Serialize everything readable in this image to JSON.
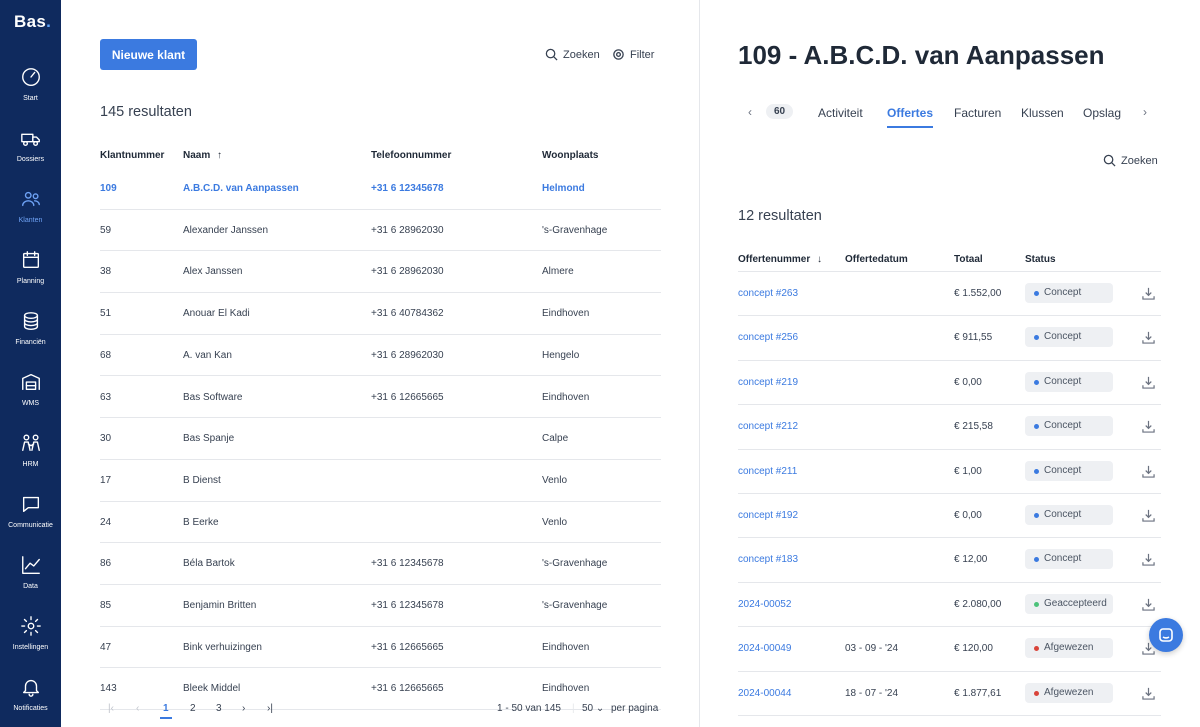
{
  "app": {
    "logo": "Bas"
  },
  "sidebar": {
    "items": [
      {
        "label": "Start",
        "icon": "gauge-icon"
      },
      {
        "label": "Dossiers",
        "icon": "truck-icon"
      },
      {
        "label": "Klanten",
        "icon": "users-icon",
        "active": true
      },
      {
        "label": "Planning",
        "icon": "calendar-icon"
      },
      {
        "label": "Financiën",
        "icon": "coins-icon"
      },
      {
        "label": "WMS",
        "icon": "warehouse-icon"
      },
      {
        "label": "HRM",
        "icon": "people-icon"
      },
      {
        "label": "Communicatie",
        "icon": "chat-icon"
      },
      {
        "label": "Data",
        "icon": "chart-icon"
      },
      {
        "label": "Instellingen",
        "icon": "gear-icon"
      },
      {
        "label": "Notificaties",
        "icon": "bell-icon"
      }
    ]
  },
  "customers": {
    "new_button": "Nieuwe klant",
    "search_label": "Zoeken",
    "filter_label": "Filter",
    "results": "145 resultaten",
    "columns": {
      "number": "Klantnummer",
      "name": "Naam",
      "phone": "Telefoonnummer",
      "city": "Woonplaats"
    },
    "rows": [
      {
        "number": "109",
        "name": "A.B.C.D. van Aanpassen",
        "phone": "+31 6 12345678",
        "city": "Helmond",
        "selected": true
      },
      {
        "number": "59",
        "name": "Alexander Janssen",
        "phone": "+31 6 28962030",
        "city": "'s-Gravenhage"
      },
      {
        "number": "38",
        "name": "Alex Janssen",
        "phone": "+31 6 28962030",
        "city": "Almere"
      },
      {
        "number": "51",
        "name": "Anouar El Kadi",
        "phone": "+31 6 40784362",
        "city": "Eindhoven"
      },
      {
        "number": "68",
        "name": "A. van Kan",
        "phone": "+31 6 28962030",
        "city": "Hengelo"
      },
      {
        "number": "63",
        "name": "Bas Software",
        "phone": "+31 6 12665665",
        "city": "Eindhoven"
      },
      {
        "number": "30",
        "name": "Bas Spanje",
        "phone": "",
        "city": "Calpe"
      },
      {
        "number": "17",
        "name": "B Dienst",
        "phone": "",
        "city": "Venlo"
      },
      {
        "number": "24",
        "name": "B Eerke",
        "phone": "",
        "city": "Venlo"
      },
      {
        "number": "86",
        "name": "Béla Bartok",
        "phone": "+31 6 12345678",
        "city": "'s-Gravenhage"
      },
      {
        "number": "85",
        "name": "Benjamin Britten",
        "phone": "+31 6 12345678",
        "city": "'s-Gravenhage"
      },
      {
        "number": "47",
        "name": "Bink verhuizingen",
        "phone": "+31 6 12665665",
        "city": "Eindhoven"
      },
      {
        "number": "143",
        "name": "Bleek Middel",
        "phone": "+31 6 12665665",
        "city": "Eindhoven"
      }
    ],
    "pagination": {
      "pages": [
        "1",
        "2",
        "3"
      ],
      "current": "1",
      "range": "1 - 50 van 145",
      "per_page": "50",
      "per_page_label": "per pagina"
    }
  },
  "detail": {
    "title": "109 - A.B.C.D. van Aanpassen",
    "tabs": {
      "badge": "60",
      "items": [
        "Activiteit",
        "Offertes",
        "Facturen",
        "Klussen",
        "Opslag"
      ],
      "active": "Offertes"
    },
    "search_label": "Zoeken",
    "results": "12 resultaten",
    "columns": {
      "number": "Offertenummer",
      "date": "Offertedatum",
      "total": "Totaal",
      "status": "Status"
    },
    "quotes": [
      {
        "number": "concept #263",
        "date": "",
        "total": "€ 1.552,00",
        "status": "Concept",
        "color": "#3b7ae0"
      },
      {
        "number": "concept #256",
        "date": "",
        "total": "€ 911,55",
        "status": "Concept",
        "color": "#3b7ae0"
      },
      {
        "number": "concept #219",
        "date": "",
        "total": "€ 0,00",
        "status": "Concept",
        "color": "#3b7ae0"
      },
      {
        "number": "concept #212",
        "date": "",
        "total": "€ 215,58",
        "status": "Concept",
        "color": "#3b7ae0"
      },
      {
        "number": "concept #211",
        "date": "",
        "total": "€ 1,00",
        "status": "Concept",
        "color": "#3b7ae0"
      },
      {
        "number": "concept #192",
        "date": "",
        "total": "€ 0,00",
        "status": "Concept",
        "color": "#3b7ae0"
      },
      {
        "number": "concept #183",
        "date": "",
        "total": "€ 12,00",
        "status": "Concept",
        "color": "#3b7ae0"
      },
      {
        "number": "2024-00052",
        "date": "",
        "total": "€ 2.080,00",
        "status": "Geaccepteerd",
        "color": "#4cc27a"
      },
      {
        "number": "2024-00049",
        "date": "03 - 09 - '24",
        "total": "€ 120,00",
        "status": "Afgewezen",
        "color": "#d9443a"
      },
      {
        "number": "2024-00044",
        "date": "18 - 07 - '24",
        "total": "€ 1.877,61",
        "status": "Afgewezen",
        "color": "#d9443a"
      }
    ]
  }
}
